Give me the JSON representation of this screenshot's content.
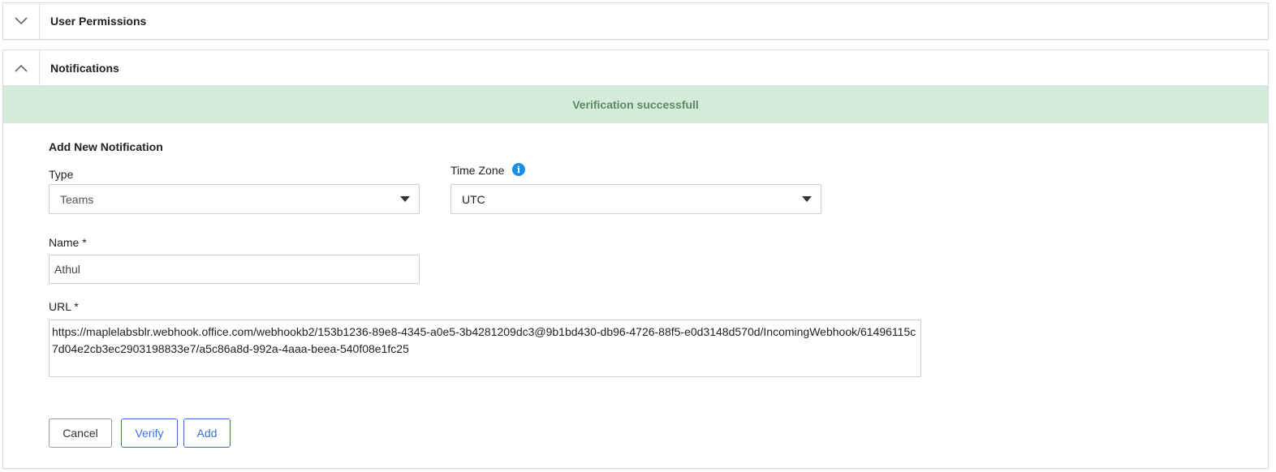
{
  "sections": {
    "user_permissions": {
      "title": "User Permissions",
      "toggle_icon": "chevron-down-icon"
    },
    "notifications": {
      "title": "Notifications",
      "toggle_icon": "chevron-up-icon"
    }
  },
  "alert": {
    "message": "Verification successfull",
    "background": "#d4ebd9",
    "color": "#5b8a63"
  },
  "form": {
    "title": "Add New Notification",
    "type": {
      "label": "Type",
      "value": "Teams"
    },
    "timezone": {
      "label": "Time Zone",
      "value": "UTC",
      "info_icon": "info-icon"
    },
    "name": {
      "label": "Name *",
      "value": "Athul"
    },
    "url": {
      "label": "URL *",
      "value": "https://maplelabsblr.webhook.office.com/webhookb2/153b1236-89e8-4345-a0e5-3b4281209dc3@9b1bd430-db96-4726-88f5-e0d3148d570d/IncomingWebhook/61496115c7d04e2cb3ec2903198833e7/a5c86a8d-992a-4aaa-beea-540f08e1fc25"
    }
  },
  "buttons": {
    "cancel": "Cancel",
    "verify": "Verify",
    "add": "Add"
  },
  "colors": {
    "accent": "#3b6fd8",
    "info": "#1a8fe0"
  }
}
